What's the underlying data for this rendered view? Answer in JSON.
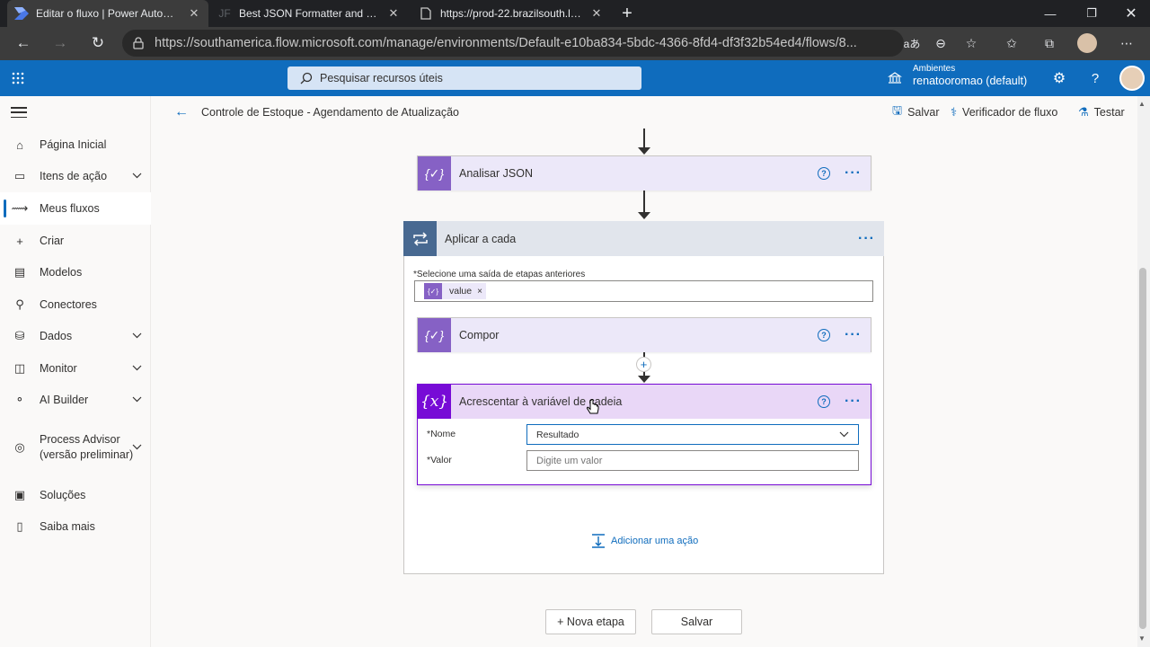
{
  "browser": {
    "tabs": [
      {
        "title": "Editar o fluxo | Power Automate",
        "favicon": "power-automate-icon",
        "active": true
      },
      {
        "title": "Best JSON Formatter and JSON V",
        "favicon": "jf-icon",
        "favicon_text": "JF",
        "active": false
      },
      {
        "title": "https://prod-22.brazilsouth.logic",
        "favicon": "page-icon",
        "active": false
      }
    ],
    "url": "https://southamerica.flow.microsoft.com/manage/environments/Default-e10ba834-5bdc-4366-8fd4-df3f32b54ed4/flows/8..."
  },
  "header": {
    "search_placeholder": "Pesquisar recursos úteis",
    "env_label": "Ambientes",
    "env_name": "renatooromao (default)"
  },
  "sidebar": {
    "items": [
      {
        "label": "Página Inicial",
        "icon": "home-icon"
      },
      {
        "label": "Itens de ação",
        "icon": "action-items-icon",
        "chevron": true
      },
      {
        "label": "Meus fluxos",
        "icon": "flows-icon",
        "active": true
      },
      {
        "label": "Criar",
        "icon": "plus-icon"
      },
      {
        "label": "Modelos",
        "icon": "templates-icon"
      },
      {
        "label": "Conectores",
        "icon": "connectors-icon"
      },
      {
        "label": "Dados",
        "icon": "data-icon",
        "chevron": true
      },
      {
        "label": "Monitor",
        "icon": "monitor-icon",
        "chevron": true
      },
      {
        "label": "AI Builder",
        "icon": "ai-builder-icon",
        "chevron": true
      },
      {
        "label": "Process Advisor (versão preliminar)",
        "icon": "process-advisor-icon",
        "chevron": true
      },
      {
        "label": "Soluções",
        "icon": "solutions-icon"
      },
      {
        "label": "Saiba mais",
        "icon": "learn-icon"
      }
    ]
  },
  "cmdbar": {
    "flow_title": "Controle de Estoque - Agendamento de Atualização",
    "save": "Salvar",
    "checker": "Verificador de fluxo",
    "test": "Testar"
  },
  "flow": {
    "parse_json": {
      "title": "Analisar JSON"
    },
    "apply_each": {
      "title": "Aplicar a cada",
      "select_label": "*Selecione uma saída de etapas anteriores",
      "token": "value"
    },
    "compose": {
      "title": "Compor"
    },
    "append": {
      "title": "Acrescentar à variável de cadeia",
      "name_label": "*Nome",
      "name_value": "Resultado",
      "value_label": "*Valor",
      "value_placeholder": "Digite um valor"
    },
    "add_action": "Adicionar uma ação"
  },
  "footer": {
    "new_step": "+ Nova etapa",
    "save": "Salvar"
  },
  "colors": {
    "brand": "#0f6cbd",
    "data_operation": "#8661c5",
    "variable": "#770bd6",
    "control": "#486991"
  }
}
